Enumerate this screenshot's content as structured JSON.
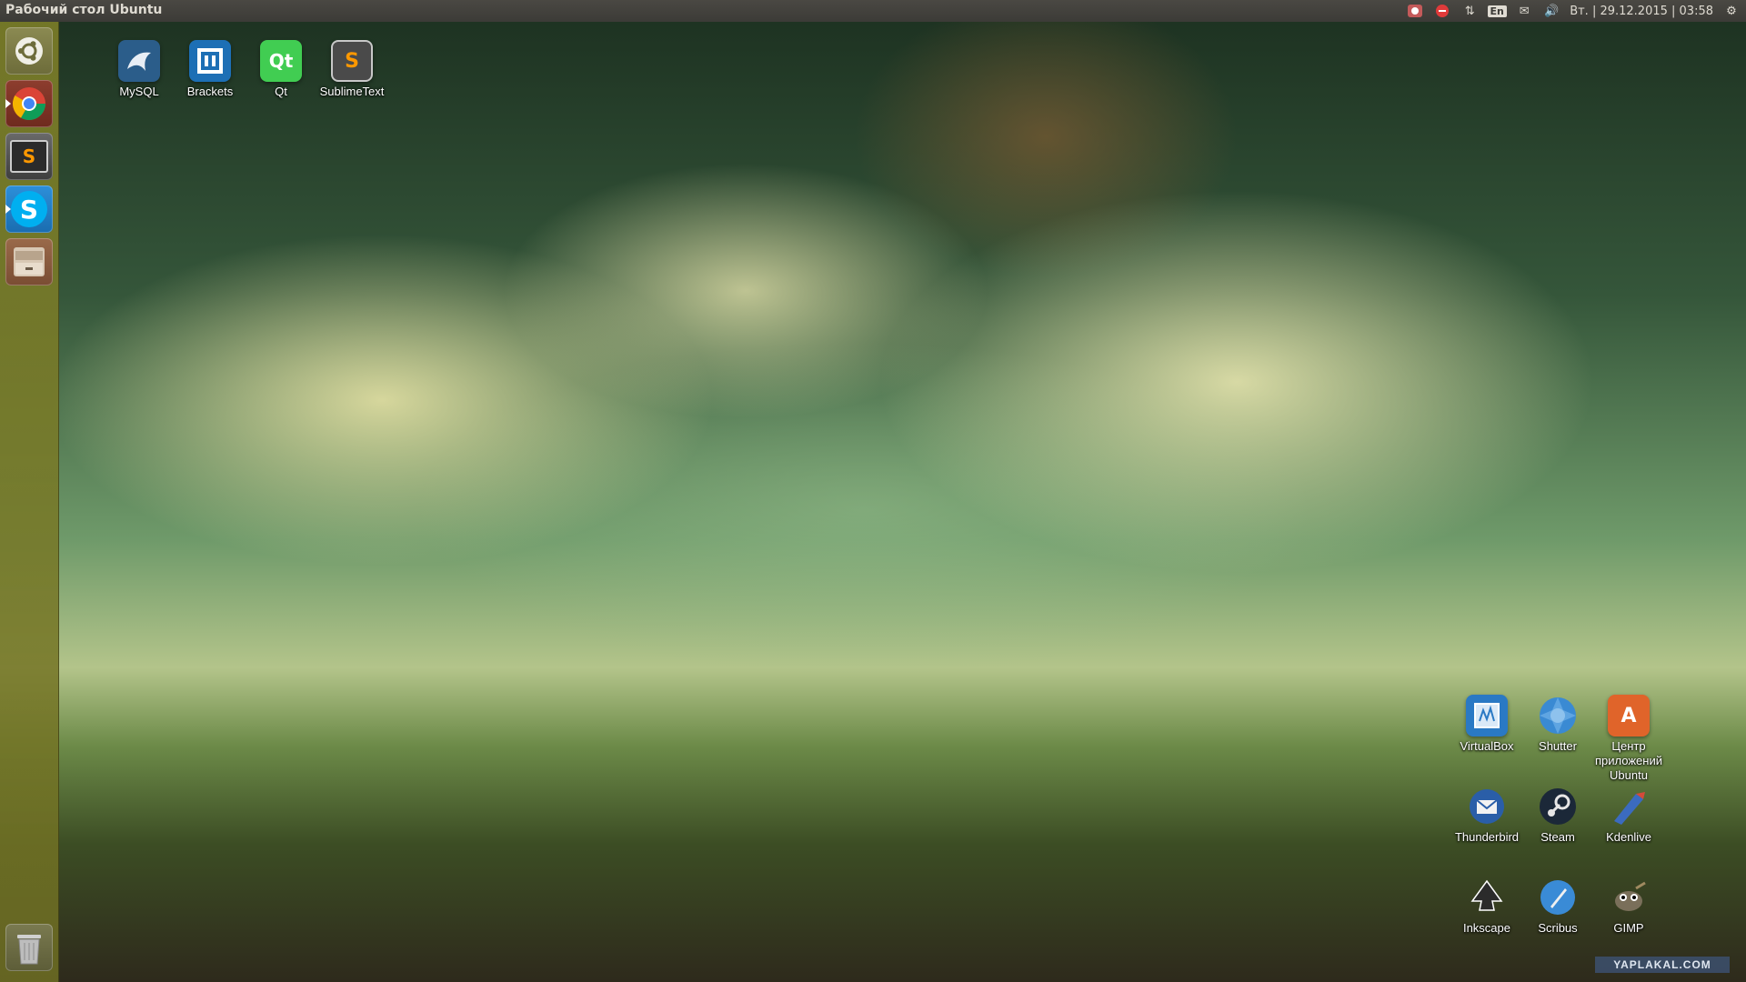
{
  "top_panel": {
    "title": "Рабочий стол Ubuntu",
    "tray": {
      "language": "En",
      "datetime": "Вт. | 29.12.2015 | 03:58"
    }
  },
  "launcher": {
    "items": [
      {
        "name": "ubuntu-dash",
        "icon": "ubuntu-logo-icon"
      },
      {
        "name": "chrome",
        "icon": "chrome-icon"
      },
      {
        "name": "sublime-text",
        "icon": "sublime-text-icon",
        "glyph": "S"
      },
      {
        "name": "skype",
        "icon": "skype-icon",
        "glyph": "S"
      },
      {
        "name": "file-manager",
        "icon": "file-cabinet-icon"
      }
    ],
    "trash": {
      "icon": "trash-icon"
    }
  },
  "desktop_icons": {
    "mysql": {
      "label": "MySQL",
      "icon": "mysql-dolphin-icon",
      "color": "#2b5d8a"
    },
    "brackets": {
      "label": "Brackets",
      "icon": "brackets-icon",
      "color": "#1d6fb5"
    },
    "qt": {
      "label": "Qt",
      "glyph": "Qt",
      "icon": "qt-icon",
      "color": "#41cd52"
    },
    "sublimetext": {
      "label": "SublimeText",
      "glyph": "S",
      "icon": "sublime-text-icon",
      "color": "#4a4a4a"
    },
    "virtualbox": {
      "label": "VirtualBox",
      "icon": "virtualbox-icon",
      "color": "#2a79c4"
    },
    "shutter": {
      "label": "Shutter",
      "icon": "shutter-icon",
      "color": "#3a8ad3"
    },
    "software_center": {
      "label": "Центр приложений Ubuntu",
      "glyph": "A",
      "icon": "ubuntu-software-center-icon",
      "color": "#e0642a"
    },
    "thunderbird": {
      "label": "Thunderbird",
      "icon": "thunderbird-icon",
      "color": "#2a5ea8"
    },
    "steam": {
      "label": "Steam",
      "icon": "steam-icon",
      "color": "#1b2838"
    },
    "kdenlive": {
      "label": "Kdenlive",
      "icon": "kdenlive-icon",
      "color": "#3b6bbf"
    },
    "inkscape": {
      "label": "Inkscape",
      "icon": "inkscape-icon",
      "color": "#2b2b2b"
    },
    "scribus": {
      "label": "Scribus",
      "icon": "scribus-icon",
      "color": "#3a8bd6"
    },
    "gimp": {
      "label": "GIMP",
      "icon": "gimp-icon",
      "color": "#7a6f5a"
    }
  },
  "watermark": "YAPLAKAL.COM"
}
